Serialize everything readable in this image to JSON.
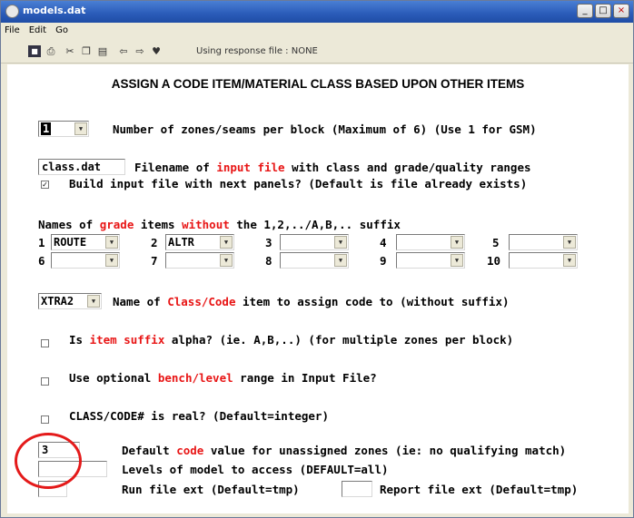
{
  "window": {
    "title": "models.dat",
    "buttons": {
      "minimize": "_",
      "maximize": "□",
      "close": "×"
    }
  },
  "menu": [
    "File",
    "Edit",
    "Go"
  ],
  "toolbar": {
    "icons": [
      "save-icon",
      "print-icon",
      "cut-icon",
      "copy-icon",
      "paste-icon",
      "back-arrow-icon",
      "forward-arrow-icon",
      "help-icon"
    ],
    "response_file_text": "Using response file : NONE"
  },
  "panel": {
    "heading": "ASSIGN A CODE ITEM/MATERIAL CLASS BASED UPON OTHER ITEMS",
    "zones": {
      "value": "1",
      "label": "Number of zones/seams per block (Maximum of 6) (Use 1 for GSM)"
    },
    "filename": {
      "value": "class.dat",
      "label_pre": "Filename of ",
      "label_red": "input file",
      "label_post": " with class and grade/quality ranges"
    },
    "build_input": {
      "checked": true,
      "label": "Build input file with next panels? (Default is file already exists)"
    },
    "grade_items": {
      "label_1": "Names of ",
      "label_red_1": "grade",
      "label_2": " items ",
      "label_red_2": "without",
      "label_3": " the 1,2,../A,B,.. suffix",
      "slots": [
        {
          "num": "1",
          "value": "ROUTE"
        },
        {
          "num": "2",
          "value": "ALTR"
        },
        {
          "num": "3",
          "value": ""
        },
        {
          "num": "4",
          "value": ""
        },
        {
          "num": "5",
          "value": ""
        },
        {
          "num": "6",
          "value": ""
        },
        {
          "num": "7",
          "value": ""
        },
        {
          "num": "8",
          "value": ""
        },
        {
          "num": "9",
          "value": ""
        },
        {
          "num": "10",
          "value": ""
        }
      ]
    },
    "class_item": {
      "value": "XTRA2",
      "label_pre": "Name of ",
      "label_red": "Class/Code",
      "label_post": " item to assign code to (without suffix)"
    },
    "item_suffix": {
      "checked": false,
      "label_pre": "Is ",
      "label_red": "item suffix",
      "label_post": " alpha? (ie. A,B,..) (for multiple zones per block)"
    },
    "bench_level": {
      "checked": false,
      "label_pre": "Use optional ",
      "label_red": "bench/level",
      "label_post": " range in Input File?"
    },
    "class_real": {
      "checked": false,
      "label": "CLASS/CODE# is real? (Default=integer)"
    },
    "default_code": {
      "value": "3",
      "label_pre": "Default ",
      "label_red": "code",
      "label_post": " value for unassigned zones (ie: no qualifying match)"
    },
    "levels": {
      "value": "",
      "label": "Levels of model to access (DEFAULT=all)"
    },
    "run_ext": {
      "value": "",
      "label": "Run file ext (Default=tmp)"
    },
    "report_ext": {
      "value": "",
      "label": "Report file ext (Default=tmp)"
    }
  },
  "colors": {
    "accent_red": "#e81515",
    "title_blue": "#2a5bb8",
    "annotation_circle": "#e41a1a"
  }
}
